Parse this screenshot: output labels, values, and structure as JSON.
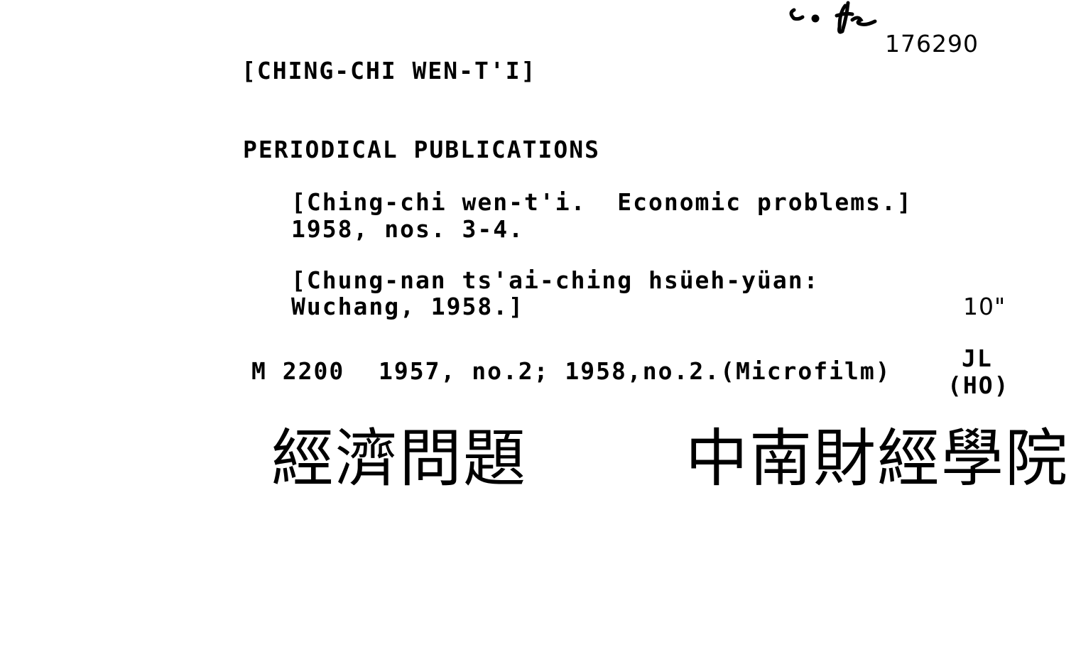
{
  "card": {
    "accession_number": "176290",
    "handwritten_note": "c. Yen",
    "heading": "[CHING-CHI WEN-T'I]",
    "subject": "PERIODICAL PUBLICATIONS",
    "title_line1": "[Ching-chi wen-t'i.  Economic problems.]",
    "title_line2": "1958, nos. 3-4.",
    "imprint_line1": "[Chung-nan ts'ai-ching hsüeh-yüan:",
    "imprint_line2": "Wuchang, 1958.]",
    "size": "10\"",
    "call_number": "M 2200",
    "holdings": "1957, no.2; 1958,no.2.(Microfilm)",
    "location_line1": "JL",
    "location_line2": "(HO)",
    "handwritten_chinese_title": "經濟問題",
    "handwritten_chinese_publisher": "中南財經學院"
  }
}
